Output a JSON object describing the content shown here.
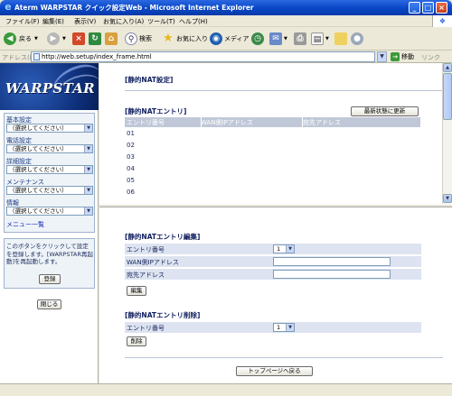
{
  "window": {
    "title": "Aterm WARPSTAR クイック設定Web - Microsoft Internet Explorer"
  },
  "menu": [
    "ファイル(F)",
    "編集(E)",
    "表示(V)",
    "お気に入り(A)",
    "ツール(T)",
    "ヘルプ(H)"
  ],
  "toolbar": {
    "back": "戻る",
    "search": "検索",
    "favorites": "お気に入り",
    "media": "メディア"
  },
  "address": {
    "label": "アドレス(D)",
    "url": "http://web.setup/index_frame.html",
    "go": "移動",
    "links": "リンク"
  },
  "sidebar": {
    "logo": "WARPSTAR",
    "sections": [
      {
        "label": "基本設定",
        "select": "（選択してください）"
      },
      {
        "label": "電話設定",
        "select": "（選択してください）"
      },
      {
        "label": "詳細設定",
        "select": "（選択してください）"
      },
      {
        "label": "メンテナンス",
        "select": "（選択してください）"
      },
      {
        "label": "情報",
        "select": "（選択してください）"
      }
    ],
    "menu_list": "メニュー一覧",
    "register_msg": "このボタンをクリックして設定を登録します。[WARPSTAR再起動]を再起動します。",
    "register_btn": "登録",
    "close_btn": "閉じる"
  },
  "top": {
    "page_title": "[静的NAT設定]",
    "entry_title": "[静的NATエントリ]",
    "refresh_btn": "最新状態に更新",
    "columns": [
      "エントリ番号",
      "WAN側IPアドレス",
      "宛先アドレス"
    ],
    "rows": [
      "01",
      "02",
      "03",
      "04",
      "05",
      "06"
    ]
  },
  "bottom": {
    "edit_title": "[静的NATエントリ編集]",
    "edit_rows": {
      "entry_label": "エントリ番号",
      "entry_value": "1",
      "wan_label": "WAN側IPアドレス",
      "dest_label": "宛先アドレス"
    },
    "edit_btn": "編集",
    "delete_title": "[静的NATエントリ削除]",
    "delete_rows": {
      "entry_label": "エントリ番号",
      "entry_value": "1"
    },
    "delete_btn": "削除",
    "top_page_btn": "トップページへ戻る"
  },
  "colors": {
    "title_bar": "#0a48c8",
    "nav_panel": "#eef3f8",
    "table_header": "#c0c8d8",
    "form_row": "#dde3f0",
    "heading_text": "#112060"
  }
}
